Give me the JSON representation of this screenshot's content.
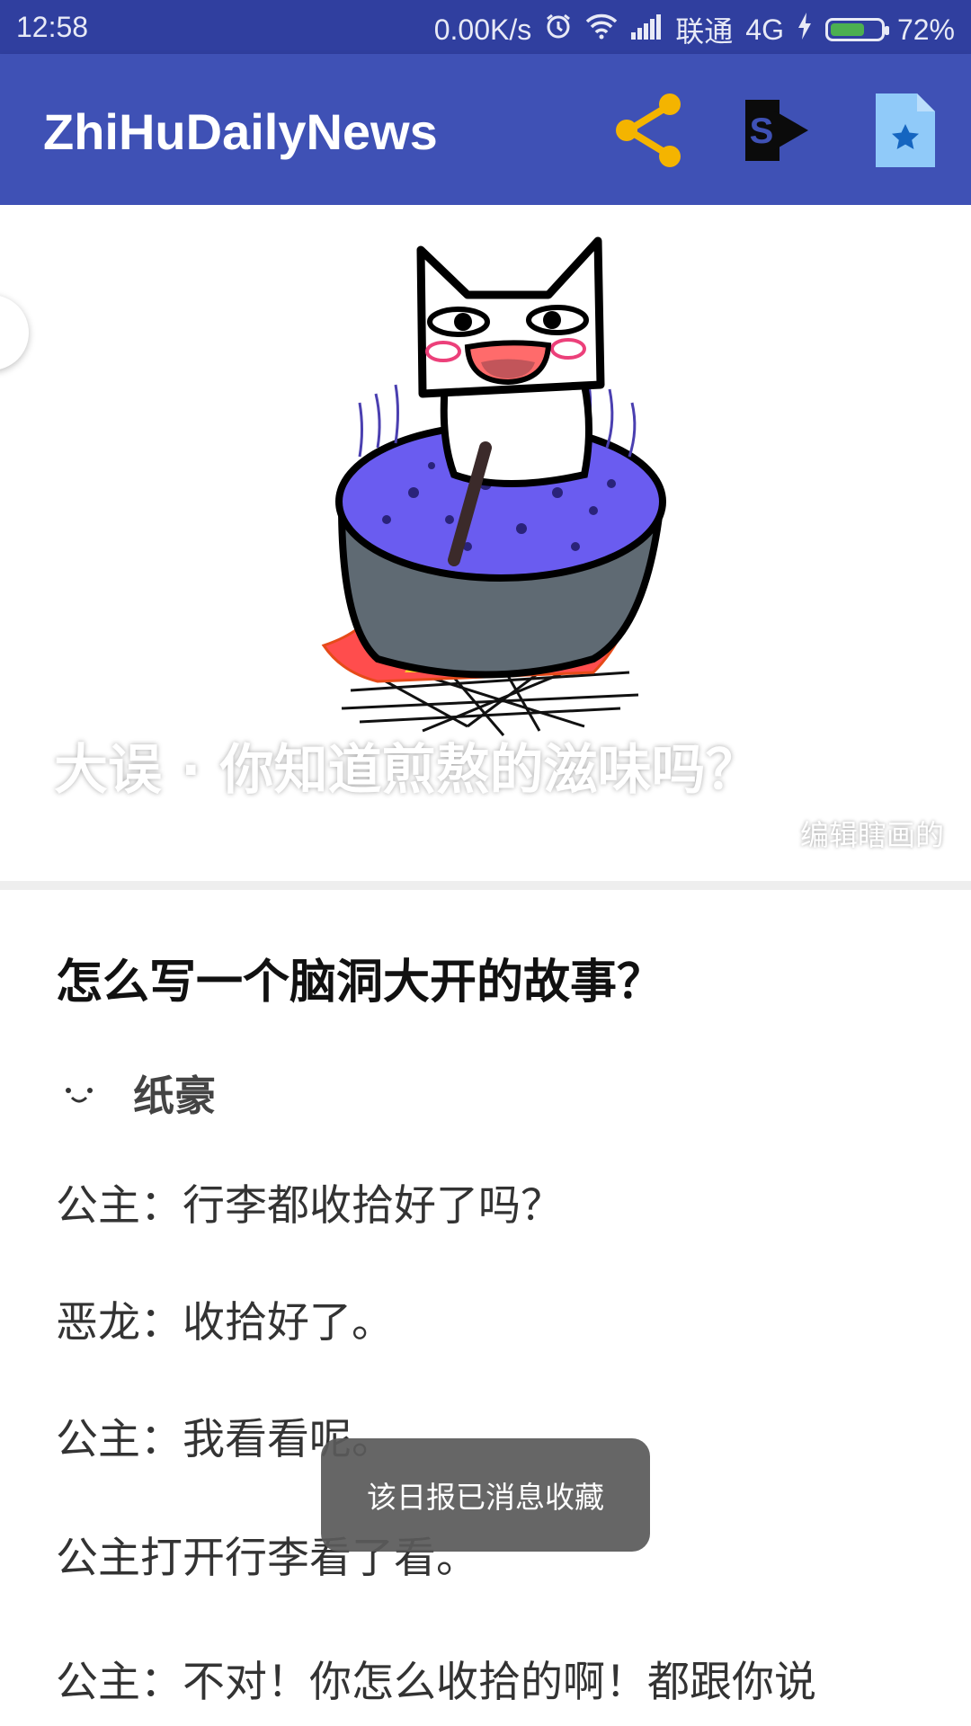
{
  "status_bar": {
    "time": "12:58",
    "speed": "0.00K/s",
    "carrier": "联通",
    "network": "4G",
    "battery": "72%",
    "battery_level": 0.72
  },
  "app_bar": {
    "title": "ZhiHuDailyNews",
    "icons": [
      "share-icon",
      "sharepoint-icon",
      "favorite-doc-icon"
    ],
    "colors": {
      "primary": "#3f51b5",
      "primary_dark": "#303f9f",
      "share": "#f4b400"
    }
  },
  "header": {
    "title": "大误 · 你知道煎熬的滋味吗？",
    "image_source": "编辑瞎画的"
  },
  "article": {
    "question": "怎么写一个脑洞大开的故事？",
    "author": "纸豪",
    "paragraphs": [
      "公主：行李都收拾好了吗？",
      "恶龙：收拾好了。",
      "公主：我看看呢。",
      "公主打开行李看了看。",
      "公主：不对！你怎么收拾的啊！都跟你说"
    ]
  },
  "toast": "该日报已消息收藏"
}
